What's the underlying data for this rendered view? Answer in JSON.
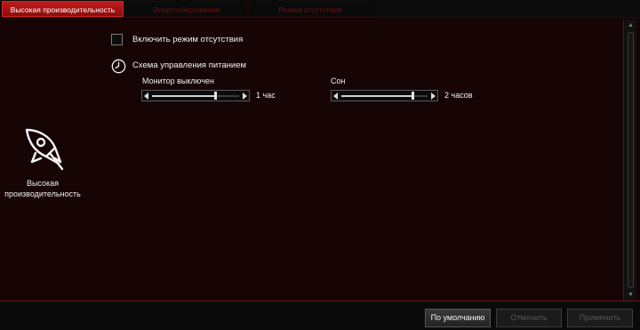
{
  "tabs": [
    {
      "label": "Высокая производительность",
      "active": true
    },
    {
      "label": "Энергосбережение",
      "active": false
    },
    {
      "label": "Режим отсутствия",
      "active": false
    }
  ],
  "profile": {
    "icon": "rocket-icon",
    "label_line1": "Высокая",
    "label_line2": "производительность"
  },
  "away_mode": {
    "label": "Включить режим отсутствия",
    "checked": false
  },
  "power_plan": {
    "icon": "clock-icon",
    "label": "Схема управления питанием"
  },
  "monitor_off": {
    "label": "Монитор выключен",
    "value": "1 час",
    "level": 0.72
  },
  "sleep": {
    "label": "Сон",
    "value": "2 часов",
    "level": 0.82
  },
  "buttons": {
    "default": "По умолчанию",
    "cancel": "Отменить",
    "apply": "Применить"
  },
  "colors": {
    "accent": "#c01a1a",
    "background": "#170404"
  }
}
